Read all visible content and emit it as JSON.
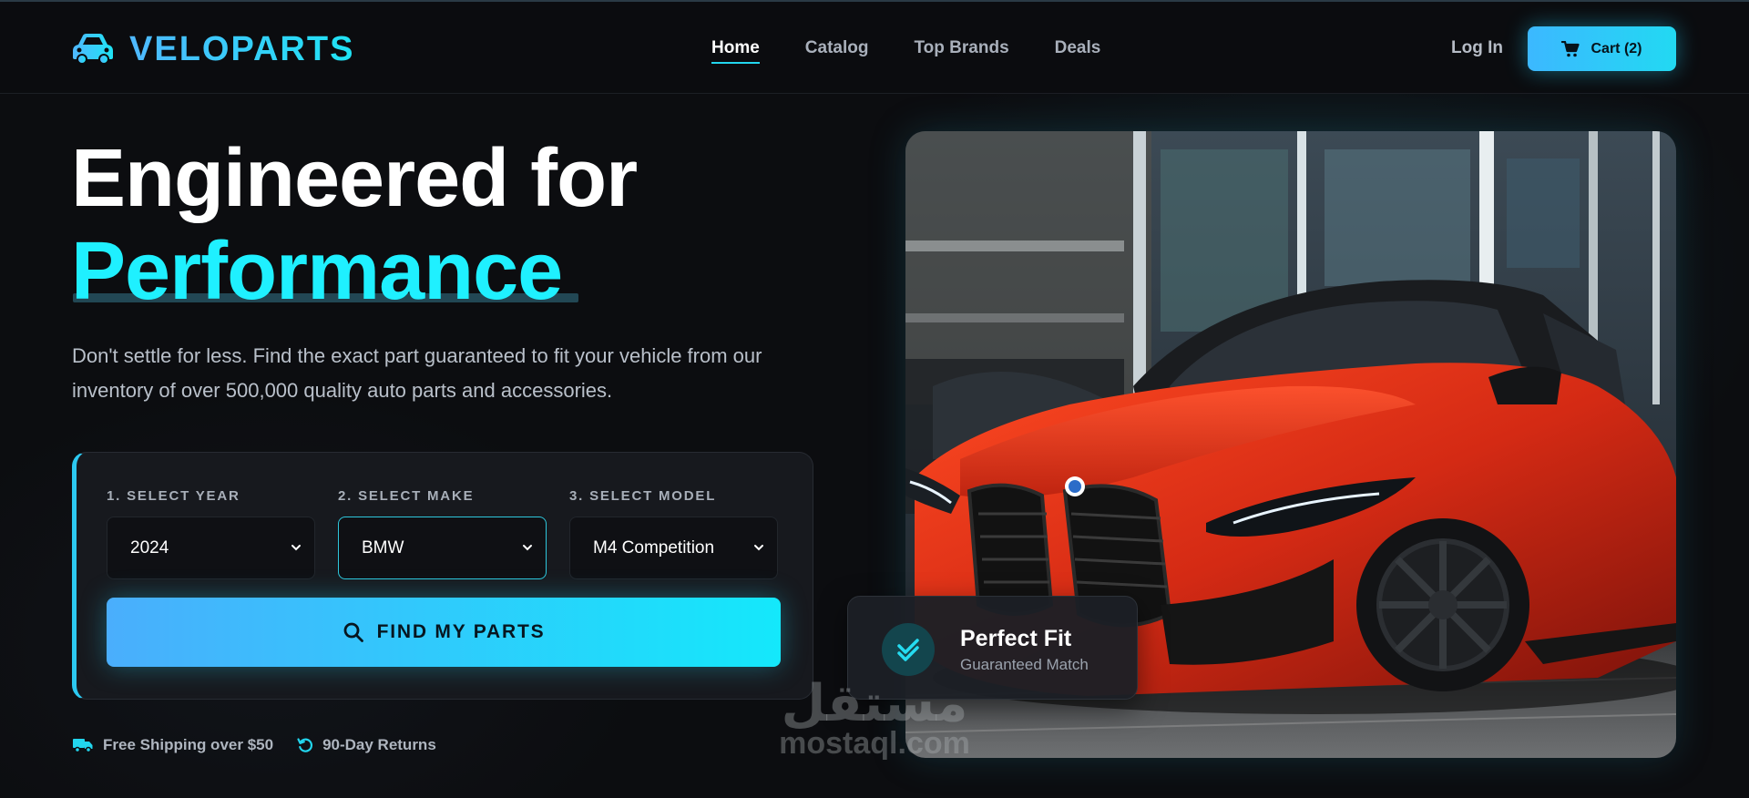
{
  "nav": {
    "logo_text": "VELOPARTS",
    "links": [
      "Home",
      "Catalog",
      "Top Brands",
      "Deals"
    ],
    "active_link": "Home",
    "login_label": "Log In",
    "cart_label": "Cart (2)"
  },
  "hero": {
    "headline_line1": "Engineered for",
    "headline_line2": "Performance",
    "description": "Don't settle for less. Find the exact part guaranteed to fit your vehicle from our inventory of over 500,000 quality auto parts and accessories."
  },
  "selector": {
    "year_label": "1. SELECT YEAR",
    "year_value": "2024",
    "make_label": "2. SELECT MAKE",
    "make_value": "BMW",
    "model_label": "3. SELECT MODEL",
    "model_value": "M4 Competition",
    "find_button": "FIND MY PARTS"
  },
  "perks": {
    "shipping": "Free Shipping over $50",
    "returns": "90-Day Returns"
  },
  "badge": {
    "title": "Perfect Fit",
    "subtitle": "Guaranteed Match"
  },
  "watermark": {
    "arabic": "مستقل",
    "latin": "mostaql.com"
  },
  "colors": {
    "accent": "#1ff0ff",
    "accent_blue": "#3cb8ff",
    "background": "#0c0d10",
    "card": "#17191e",
    "car_red": "#d8301a"
  },
  "icons": {
    "logo": "car-icon",
    "cart": "cart-icon",
    "search": "search-icon",
    "shipping": "truck-icon",
    "returns": "rotate-icon",
    "badge": "double-check-icon",
    "select": "chevron-down-icon"
  }
}
